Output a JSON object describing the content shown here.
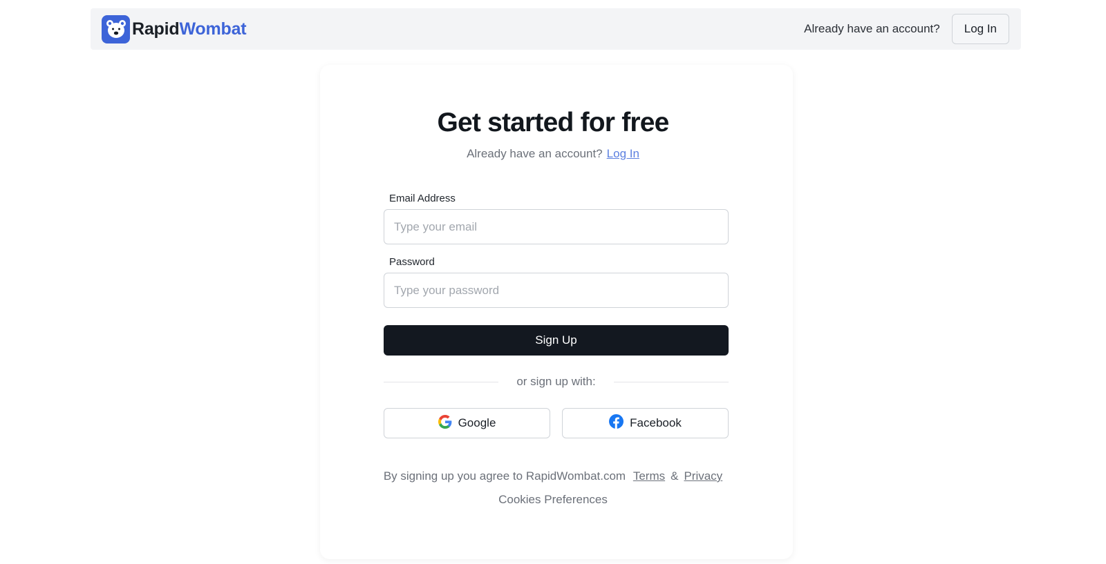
{
  "header": {
    "brand_part1": "Rapid",
    "brand_part2": "Wombat",
    "account_prompt": "Already have an account?",
    "login_label": "Log In"
  },
  "main": {
    "title": "Get started for free",
    "subtitle_text": "Already have an account?",
    "subtitle_link": "Log In",
    "email": {
      "label": "Email Address",
      "placeholder": "Type your email",
      "value": ""
    },
    "password": {
      "label": "Password",
      "placeholder": "Type your password",
      "value": ""
    },
    "signup_label": "Sign Up",
    "divider_text": "or sign up with:",
    "google_label": "Google",
    "facebook_label": "Facebook",
    "legal_text": "By signing up you agree to RapidWombat.com",
    "terms_label": "Terms",
    "amp": "&",
    "privacy_label": "Privacy",
    "cookies_label": "Cookies Preferences"
  },
  "colors": {
    "brand_blue": "#3d64d8",
    "primary_button": "#131820",
    "link": "#5b7fe0",
    "facebook_blue": "#1877f2"
  },
  "icons": {
    "logo": "wombat-face-icon",
    "google": "google-g-icon",
    "facebook": "facebook-f-icon"
  }
}
